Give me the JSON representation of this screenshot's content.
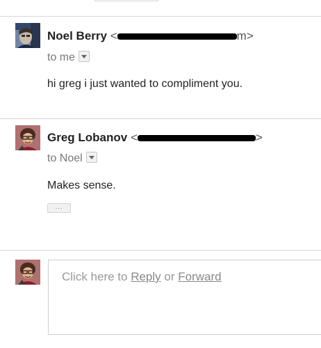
{
  "messages": [
    {
      "sender_name": "Noel Berry",
      "sender_email_open": "<",
      "sender_email_close": "m>",
      "recipient_line": "to me",
      "body": "hi greg i just wanted to compliment you."
    },
    {
      "sender_name": "Greg Lobanov",
      "sender_email_open": "<",
      "sender_email_close": ">",
      "recipient_line": "to Noel",
      "body": "Makes sense.",
      "trimmed_content_label": "..."
    }
  ],
  "reply": {
    "prefix": "Click here to ",
    "reply_link": "Reply",
    "middle": " or ",
    "forward_link": "Forward"
  },
  "icons": {
    "dropdown": "chevron-down-icon",
    "more": "ellipsis-icon"
  },
  "colors": {
    "divider": "#d9d9d9",
    "redaction": "#000000",
    "muted_text": "#777777"
  }
}
